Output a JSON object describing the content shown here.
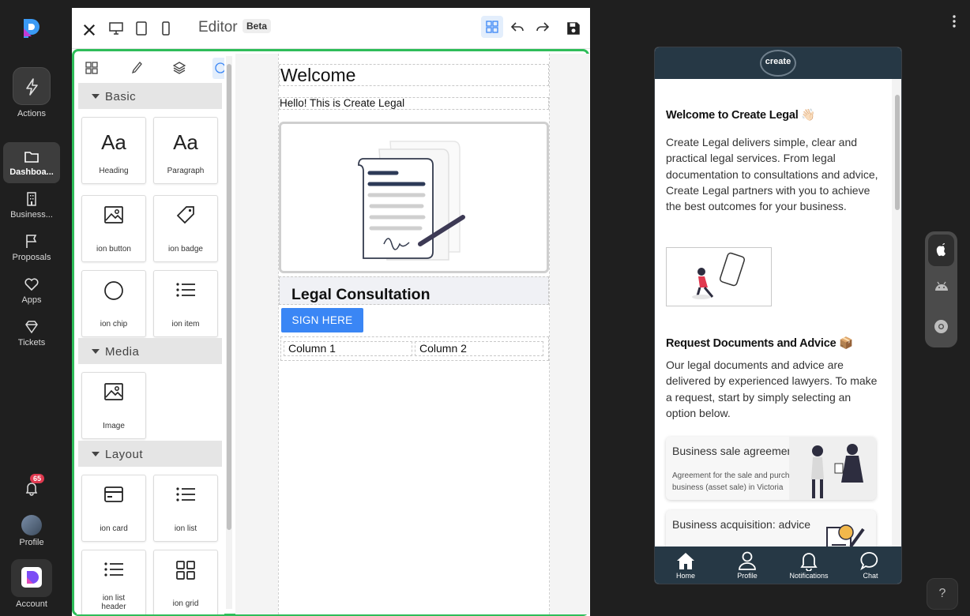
{
  "sidebar": {
    "items": [
      {
        "label": "Actions"
      },
      {
        "label": "Dashboa..."
      },
      {
        "label": "Business..."
      },
      {
        "label": "Proposals"
      },
      {
        "label": "Apps"
      },
      {
        "label": "Tickets"
      }
    ],
    "notification_count": "65",
    "profile_label": "Profile",
    "account_label": "Account"
  },
  "editor": {
    "title": "Editor",
    "beta": "Beta",
    "sections": {
      "basic": "Basic",
      "media": "Media",
      "layout": "Layout"
    },
    "components": {
      "heading": {
        "glyph": "Aa",
        "label": "Heading"
      },
      "paragraph": {
        "glyph": "Aa",
        "label": "Paragraph"
      },
      "ion_button": "ion button",
      "ion_badge": "ion badge",
      "ion_chip": "ion chip",
      "ion_item": "ion item",
      "image": "Image",
      "ion_card": "ion card",
      "ion_list": "ion list",
      "ion_list_header_1": "ion list",
      "ion_list_header_2": "header",
      "ion_grid": "ion grid"
    }
  },
  "canvas": {
    "welcome": "Welcome",
    "hello": "Hello! This is Create Legal",
    "section_title": "Legal Consultation",
    "button": "SIGN HERE",
    "column1": "Column 1",
    "column2": "Column 2"
  },
  "preview": {
    "logo": "create",
    "heading1": "Welcome to Create Legal 👋🏻",
    "para1": "Create Legal delivers simple, clear and practical legal services. From legal documentation to consultations and advice, Create Legal partners with you to achieve the best outcomes for your business.",
    "heading2": "Request Documents and Advice 📦",
    "para2": "Our legal documents and advice are delivered by experienced lawyers. To make a request, start by simply selecting an option below.",
    "card1_title": "Business sale agreement (V",
    "card1_sub": "Agreement for the sale and purchase of business (asset sale) in Victoria",
    "card2_title": "Business acquisition: advice",
    "nav": [
      "Home",
      "Profile",
      "Notifications",
      "Chat"
    ]
  },
  "help": "?",
  "colors": {
    "accent_green": "#2ebd59",
    "button_blue": "#3a86f5",
    "phone_header": "#263845",
    "badge_red": "#e0394f"
  }
}
